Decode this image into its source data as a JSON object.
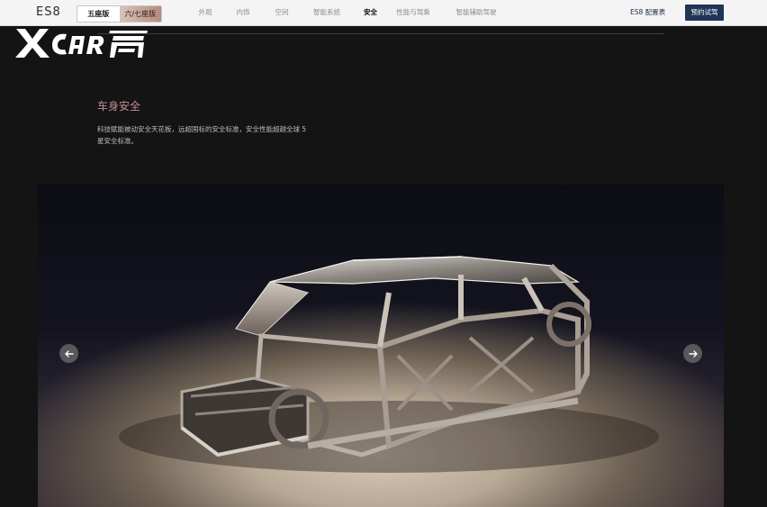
{
  "header": {
    "brand": "ES8",
    "variants": [
      {
        "label": "五座版",
        "active": true
      },
      {
        "label": "六/七座版",
        "active": false
      }
    ],
    "tabs": [
      {
        "label": "外观",
        "active": false
      },
      {
        "label": "内饰",
        "active": false
      },
      {
        "label": "空间",
        "active": false
      },
      {
        "label": "智能系统",
        "active": false
      },
      {
        "label": "安全",
        "active": true
      },
      {
        "label": "性能与驾乘",
        "active": false
      },
      {
        "label": "智能辅助驾驶",
        "active": false
      }
    ],
    "config_link": "ES8 配置表",
    "cta_label": "预约试驾"
  },
  "watermark": {
    "text": "XCAR爱卡"
  },
  "section": {
    "title": "车身安全",
    "description": "科技赋能被动安全天花板，远超国标的安全标准，安全性能超越全球 5 星安全标准。"
  },
  "hero": {
    "subject": "vehicle-body-frame",
    "prev_icon": "arrow-left-icon",
    "next_icon": "arrow-right-icon"
  },
  "colors": {
    "nav_bg": "#f4f4f4",
    "page_bg": "#141414",
    "title_accent": "#c58e98",
    "cta_bg": "#1f3556"
  }
}
